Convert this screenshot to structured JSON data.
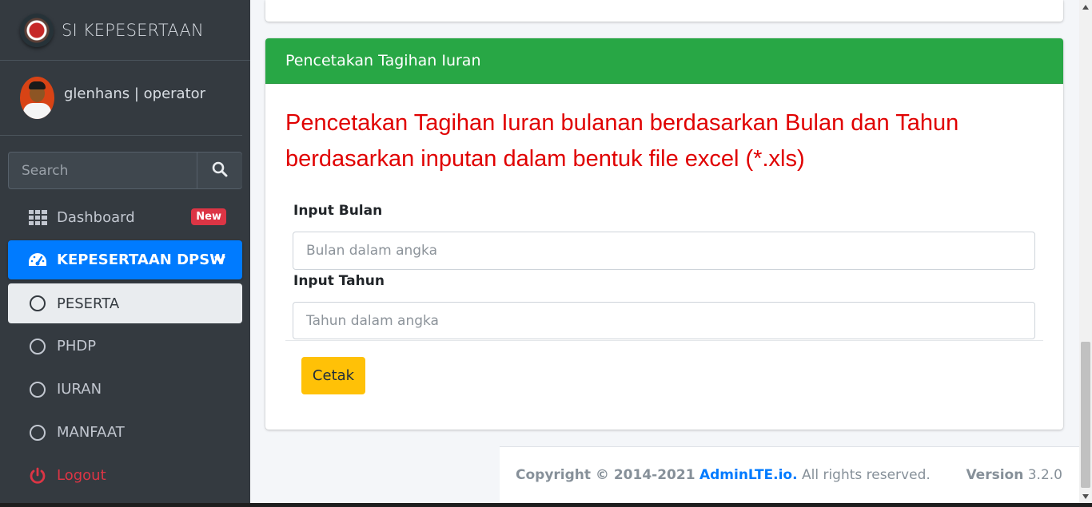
{
  "sidebar": {
    "brand": "SI KEPESERTAAN",
    "user": "glenhans | operator",
    "search_placeholder": "Search",
    "items": [
      {
        "label": "Dashboard",
        "badge": "New",
        "icon": "grid-icon"
      },
      {
        "label": "KEPESERTAAN DPSW",
        "icon": "tachometer-icon",
        "active": true
      },
      {
        "label": "PESERTA",
        "icon": "circle-icon",
        "selected": true
      },
      {
        "label": "PHDP",
        "icon": "circle-icon"
      },
      {
        "label": "IURAN",
        "icon": "circle-icon"
      },
      {
        "label": "MANFAAT",
        "icon": "circle-icon"
      },
      {
        "label": "Logout",
        "icon": "power-icon"
      }
    ]
  },
  "card": {
    "title": "Pencetakan Tagihan Iuran",
    "description": "Pencetakan Tagihan Iuran bulanan berdasarkan Bulan dan Tahun berdasarkan inputan dalam bentuk file excel (*.xls)",
    "bulan_label": "Input Bulan",
    "bulan_placeholder": "Bulan dalam angka",
    "tahun_label": "Input Tahun",
    "tahun_placeholder": "Tahun dalam angka",
    "button": "Cetak"
  },
  "footer": {
    "copyright": "Copyright © 2014-2021",
    "link": "AdminLTE.io.",
    "rights": "All rights reserved.",
    "version_label": "Version",
    "version": "3.2.0"
  },
  "colors": {
    "sidebar_bg": "#343a40",
    "primary": "#007bff",
    "success": "#28a745",
    "warning": "#ffc107",
    "danger": "#dc3545"
  }
}
